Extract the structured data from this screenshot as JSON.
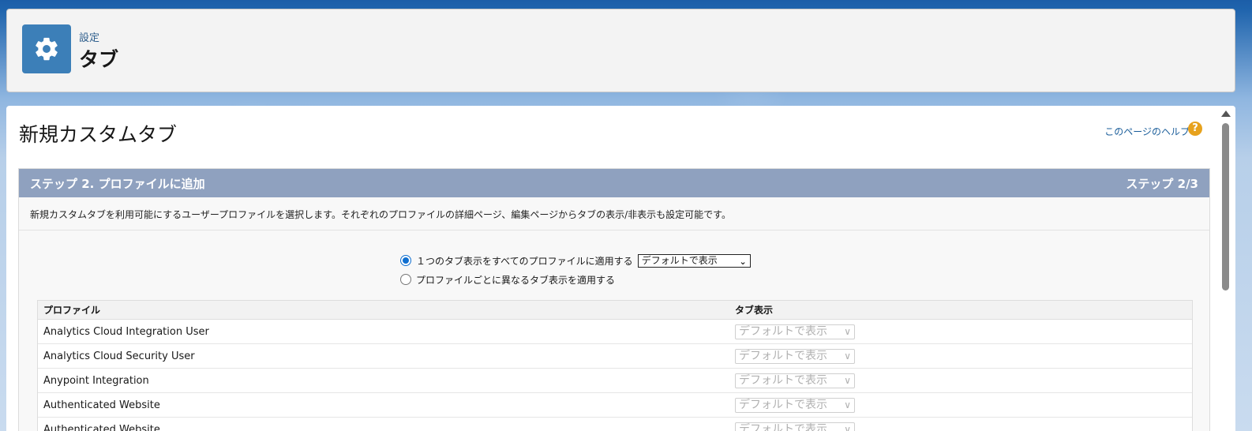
{
  "header": {
    "breadcrumb": "設定",
    "title": "タブ",
    "icon": "gear-icon"
  },
  "main": {
    "title": "新規カスタムタブ",
    "help_link": "このページのヘルプ",
    "help_icon": "help-icon",
    "step": {
      "title": "ステップ 2. プロファイルに追加",
      "counter": "ステップ 2/3",
      "description": "新規カスタムタブを利用可能にするユーザープロファイルを選択します。それぞれのプロファイルの詳細ページ、編集ページからタブの表示/非表示も設定可能です。"
    },
    "options": {
      "apply_all_label": "１つのタブ表示をすべてのプロファイルに適用する",
      "apply_all_value": "デフォルトで表示",
      "apply_each_label": "プロファイルごとに異なるタブ表示を適用する",
      "selected": "apply_all"
    },
    "table": {
      "headers": [
        "プロファイル",
        "タブ表示"
      ],
      "rows": [
        {
          "profile": "Analytics Cloud Integration User",
          "visibility": "デフォルトで表示"
        },
        {
          "profile": "Analytics Cloud Security User",
          "visibility": "デフォルトで表示"
        },
        {
          "profile": "Anypoint Integration",
          "visibility": "デフォルトで表示"
        },
        {
          "profile": "Authenticated Website",
          "visibility": "デフォルトで表示"
        },
        {
          "profile": "Authenticated Website",
          "visibility": "デフォルトで表示"
        }
      ]
    }
  },
  "colors": {
    "step_header": "#8fa1bf",
    "app_icon": "#3c7fb8",
    "link": "#1a5d9a",
    "help_icon": "#e7a21d"
  }
}
